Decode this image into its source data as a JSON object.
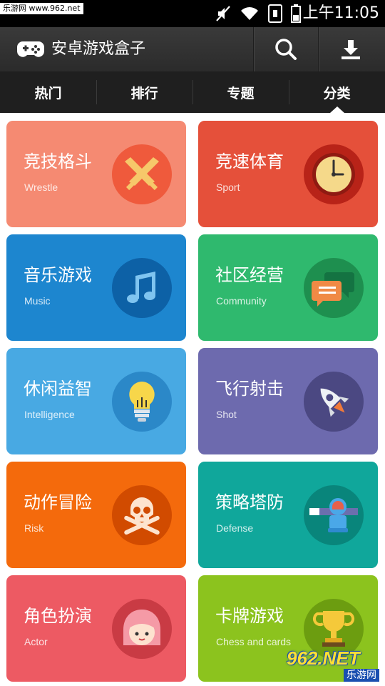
{
  "status_bar": {
    "watermark": "乐游网 www.962.net",
    "time": "上午11:05"
  },
  "app_bar": {
    "title": "安卓游戏盒子",
    "logo_icon": "gamepad-icon",
    "search_icon": "search-icon",
    "download_icon": "download-icon"
  },
  "tabs": [
    {
      "label": "热门",
      "active": false
    },
    {
      "label": "排行",
      "active": false
    },
    {
      "label": "专题",
      "active": false
    },
    {
      "label": "分类",
      "active": true
    }
  ],
  "categories": [
    {
      "cn": "竞技格斗",
      "en": "Wrestle",
      "color": "#f58a72",
      "icon_bg": "#ef5a3c",
      "icon": "crossed-swords-icon"
    },
    {
      "cn": "竞速体育",
      "en": "Sport",
      "color": "#e5503a",
      "icon_bg": "#b82318",
      "icon": "clock-icon"
    },
    {
      "cn": "音乐游戏",
      "en": "Music",
      "color": "#1d86cf",
      "icon_bg": "#0d61a6",
      "icon": "music-note-icon"
    },
    {
      "cn": "社区经营",
      "en": "Community",
      "color": "#2fb96e",
      "icon_bg": "#1e8f4f",
      "icon": "chat-bubbles-icon"
    },
    {
      "cn": "休闲益智",
      "en": "Intelligence",
      "color": "#48a9e3",
      "icon_bg": "#2b88c8",
      "icon": "light-bulb-icon"
    },
    {
      "cn": "飞行射击",
      "en": "Shot",
      "color": "#6d6aae",
      "icon_bg": "#4b4882",
      "icon": "rocket-icon"
    },
    {
      "cn": "动作冒险",
      "en": "Risk",
      "color": "#f46a0c",
      "icon_bg": "#d14b00",
      "icon": "skull-crossbones-icon"
    },
    {
      "cn": "策略塔防",
      "en": "Defense",
      "color": "#10a79b",
      "icon_bg": "#09857b",
      "icon": "turret-icon"
    },
    {
      "cn": "角色扮演",
      "en": "Actor",
      "color": "#ed5a63",
      "icon_bg": "#c93b44",
      "icon": "girl-face-icon"
    },
    {
      "cn": "卡牌游戏",
      "en": "Chess and cards",
      "color": "#8cc31e",
      "icon_bg": "#6c9d10",
      "icon": "trophy-icon"
    }
  ],
  "watermark_badge": {
    "big": "962.NET",
    "small": "乐游网"
  }
}
